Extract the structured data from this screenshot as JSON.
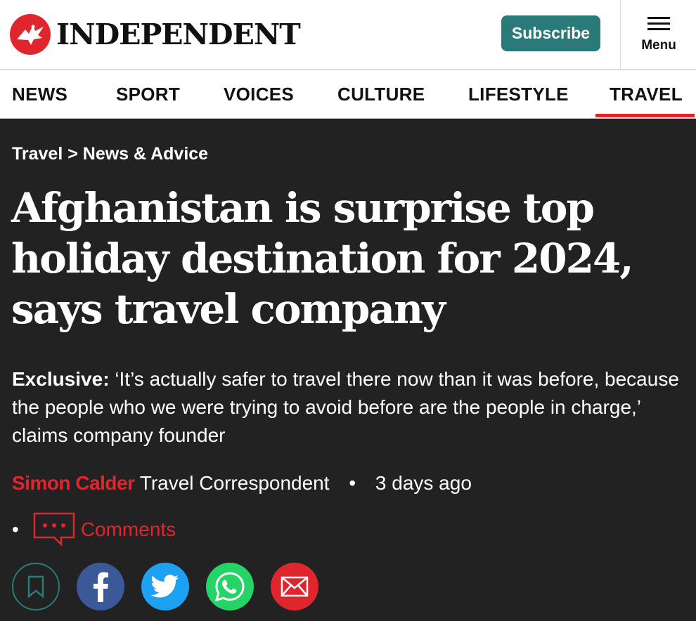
{
  "header": {
    "logo_text": "INDEPENDENT",
    "subscribe_label": "Subscribe",
    "menu_label": "Menu"
  },
  "nav": {
    "items": [
      {
        "label": "NEWS"
      },
      {
        "label": "SPORT"
      },
      {
        "label": "VOICES"
      },
      {
        "label": "CULTURE"
      },
      {
        "label": "LIFESTYLE"
      },
      {
        "label": "TRAVEL",
        "active": true
      }
    ]
  },
  "article": {
    "breadcrumb": "Travel > News & Advice",
    "headline": "Afghanistan is surprise top holiday destination for 2024, says travel company",
    "standfirst_lead": "Exclusive:",
    "standfirst_text": " ‘It’s actually safer to travel there now than it was before, because the people who we were trying to avoid before are the people in charge,’ claims company founder",
    "author": "Simon Calder",
    "author_role": "Travel Correspondent",
    "time": "3 days ago",
    "comments_label": "Comments",
    "bullet": "•"
  },
  "share": {
    "buttons": [
      {
        "icon": "bookmark-icon",
        "color": "#2b7a7a"
      },
      {
        "icon": "facebook-icon",
        "color": "#3b5998"
      },
      {
        "icon": "twitter-icon",
        "color": "#1da1f2"
      },
      {
        "icon": "whatsapp-icon",
        "color": "#25d366"
      },
      {
        "icon": "email-icon",
        "color": "#e0262d"
      }
    ]
  },
  "colors": {
    "brand_red": "#e0262d",
    "subscribe_teal": "#2b7a7a",
    "article_bg": "#222222"
  }
}
